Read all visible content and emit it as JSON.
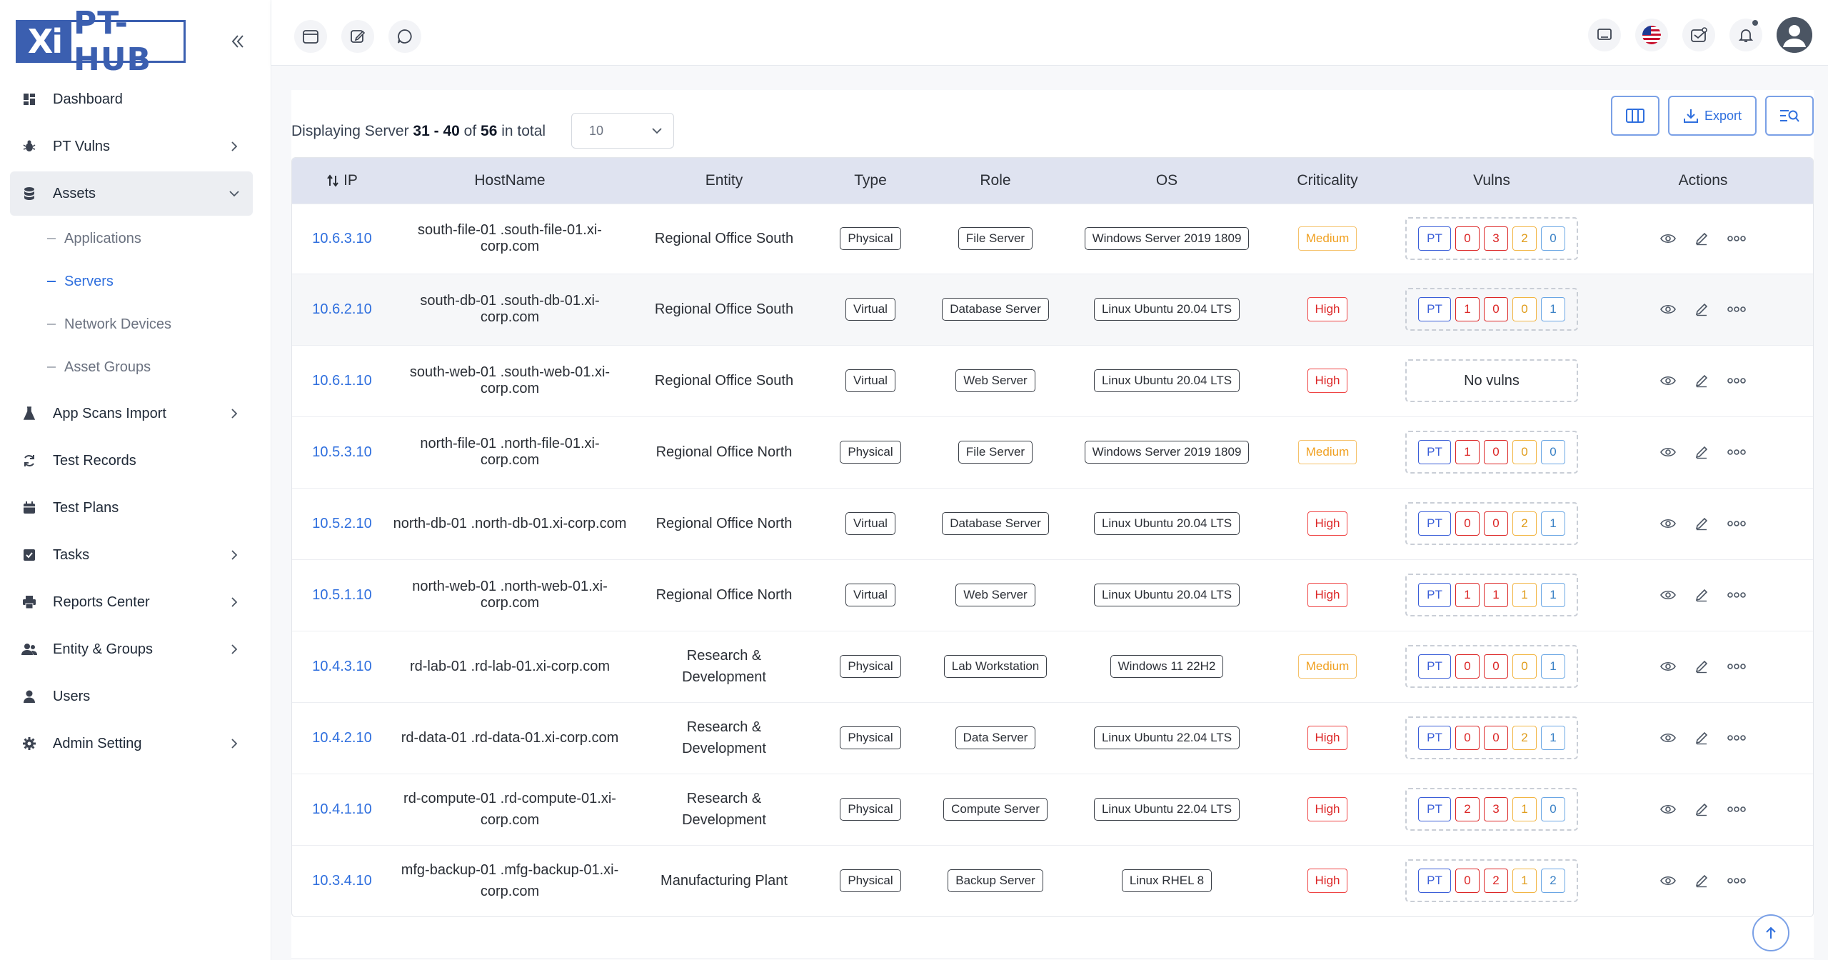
{
  "brand": {
    "logo_left": "Xi",
    "logo_right": "PT-HUB"
  },
  "sidebar": {
    "items": [
      {
        "label": "Dashboard",
        "icon": "dashboard-icon",
        "chevron": false
      },
      {
        "label": "PT Vulns",
        "icon": "bug-icon",
        "chevron": true
      },
      {
        "label": "Assets",
        "icon": "database-icon",
        "chevron": "down",
        "active": true,
        "children": [
          {
            "label": "Applications"
          },
          {
            "label": "Servers",
            "active": true
          },
          {
            "label": "Network Devices"
          },
          {
            "label": "Asset Groups"
          }
        ]
      },
      {
        "label": "App Scans Import",
        "icon": "flask-icon",
        "chevron": true
      },
      {
        "label": "Test Records",
        "icon": "sync-icon",
        "chevron": false
      },
      {
        "label": "Test Plans",
        "icon": "calendar-icon",
        "chevron": false
      },
      {
        "label": "Tasks",
        "icon": "checkbox-icon",
        "chevron": true
      },
      {
        "label": "Reports Center",
        "icon": "printer-icon",
        "chevron": true
      },
      {
        "label": "Entity & Groups",
        "icon": "users-icon",
        "chevron": true
      },
      {
        "label": "Users",
        "icon": "user-icon",
        "chevron": false
      },
      {
        "label": "Admin Setting",
        "icon": "gear-icon",
        "chevron": true
      }
    ]
  },
  "display": {
    "prefix": "Displaying Server",
    "range": "31 - 40",
    "of": "of",
    "total": "56",
    "suffix": "in total",
    "page_size": "10"
  },
  "toolbar": {
    "export_label": "Export"
  },
  "table": {
    "headers": {
      "ip": "IP",
      "hostname": "HostName",
      "entity": "Entity",
      "type": "Type",
      "role": "Role",
      "os": "OS",
      "criticality": "Criticality",
      "vulns": "Vulns",
      "actions": "Actions"
    },
    "pt_label": "PT",
    "no_vulns_label": "No vulns",
    "rows": [
      {
        "ip": "10.6.3.10",
        "host1": "south-file-01 .south-file-01.xi-corp.com",
        "host2": "",
        "entity1": "Regional Office South",
        "entity2": "",
        "type": "Physical",
        "role": "File Server",
        "os": "Windows Server 2019 1809",
        "criticality": "Medium",
        "vulns": [
          "0",
          "3",
          "2",
          "0"
        ]
      },
      {
        "ip": "10.6.2.10",
        "host1": "south-db-01 .south-db-01.xi-corp.com",
        "host2": "",
        "entity1": "Regional Office South",
        "entity2": "",
        "type": "Virtual",
        "role": "Database Server",
        "os": "Linux Ubuntu 20.04 LTS",
        "criticality": "High",
        "vulns": [
          "1",
          "0",
          "0",
          "1"
        ]
      },
      {
        "ip": "10.6.1.10",
        "host1": "south-web-01 .south-web-01.xi-corp.com",
        "host2": "",
        "entity1": "Regional Office South",
        "entity2": "",
        "type": "Virtual",
        "role": "Web Server",
        "os": "Linux Ubuntu 20.04 LTS",
        "criticality": "High",
        "vulns": null
      },
      {
        "ip": "10.5.3.10",
        "host1": "north-file-01 .north-file-01.xi-corp.com",
        "host2": "",
        "entity1": "Regional Office North",
        "entity2": "",
        "type": "Physical",
        "role": "File Server",
        "os": "Windows Server 2019 1809",
        "criticality": "Medium",
        "vulns": [
          "1",
          "0",
          "0",
          "0"
        ]
      },
      {
        "ip": "10.5.2.10",
        "host1": "north-db-01 .north-db-01.xi-corp.com",
        "host2": "",
        "entity1": "Regional Office North",
        "entity2": "",
        "type": "Virtual",
        "role": "Database Server",
        "os": "Linux Ubuntu 20.04 LTS",
        "criticality": "High",
        "vulns": [
          "0",
          "0",
          "2",
          "1"
        ]
      },
      {
        "ip": "10.5.1.10",
        "host1": "north-web-01 .north-web-01.xi-corp.com",
        "host2": "",
        "entity1": "Regional Office North",
        "entity2": "",
        "type": "Virtual",
        "role": "Web Server",
        "os": "Linux Ubuntu 20.04 LTS",
        "criticality": "High",
        "vulns": [
          "1",
          "1",
          "1",
          "1"
        ]
      },
      {
        "ip": "10.4.3.10",
        "host1": "rd-lab-01 .rd-lab-01.xi-corp.com",
        "host2": "",
        "entity1": "Research &",
        "entity2": "Development",
        "type": "Physical",
        "role": "Lab Workstation",
        "os": "Windows 11 22H2",
        "criticality": "Medium",
        "vulns": [
          "0",
          "0",
          "0",
          "1"
        ]
      },
      {
        "ip": "10.4.2.10",
        "host1": "rd-data-01 .rd-data-01.xi-corp.com",
        "host2": "",
        "entity1": "Research &",
        "entity2": "Development",
        "type": "Physical",
        "role": "Data Server",
        "os": "Linux Ubuntu 22.04 LTS",
        "criticality": "High",
        "vulns": [
          "0",
          "0",
          "2",
          "1"
        ]
      },
      {
        "ip": "10.4.1.10",
        "host1": "rd-compute-01 .rd-compute-01.xi-",
        "host2": "corp.com",
        "entity1": "Research &",
        "entity2": "Development",
        "type": "Physical",
        "role": "Compute Server",
        "os": "Linux Ubuntu 22.04 LTS",
        "criticality": "High",
        "vulns": [
          "2",
          "3",
          "1",
          "0"
        ]
      },
      {
        "ip": "10.3.4.10",
        "host1": "mfg-backup-01 .mfg-backup-01.xi-",
        "host2": "corp.com",
        "entity1": "Manufacturing Plant",
        "entity2": "",
        "type": "Physical",
        "role": "Backup Server",
        "os": "Linux RHEL 8",
        "criticality": "High",
        "vulns": [
          "0",
          "2",
          "1",
          "2"
        ]
      }
    ]
  },
  "colors": {
    "accent": "#2f6fde",
    "brand": "#3b5fb0",
    "high": "#dc2626",
    "medium": "#f0a020",
    "low": "#3b82c6",
    "header_bg": "#dfe3f0"
  }
}
